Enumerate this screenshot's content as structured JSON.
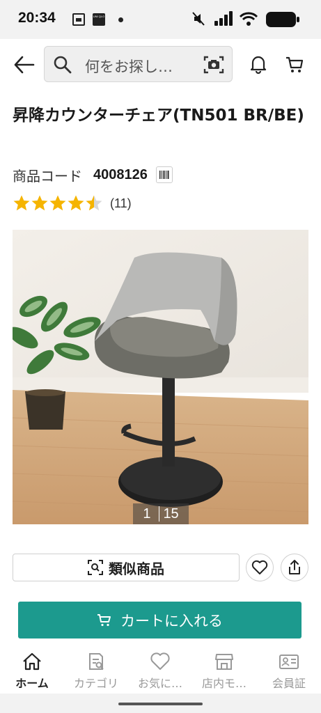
{
  "status_bar": {
    "time": "20:34",
    "app_icon_2_text": "UNI QLO"
  },
  "header": {
    "search_placeholder": "何をお探し…"
  },
  "product": {
    "title": "昇降カウンターチェア(TN501 BR/BE)",
    "code_label": "商品コード",
    "code_value": "4008126",
    "rating": 4.5,
    "rating_max": 5,
    "review_count": "(11)"
  },
  "gallery": {
    "current": "1",
    "total": "15"
  },
  "actions": {
    "similar_label": "類似商品",
    "add_to_cart_label": "カートに入れる"
  },
  "tabbar": {
    "items": [
      {
        "label": "ホーム",
        "icon": "home-icon",
        "active": true
      },
      {
        "label": "カテゴリ",
        "icon": "category-icon",
        "active": false
      },
      {
        "label": "お気に…",
        "icon": "heart-icon",
        "active": false
      },
      {
        "label": "店内モ…",
        "icon": "store-icon",
        "active": false
      },
      {
        "label": "会員証",
        "icon": "member-card-icon",
        "active": false
      }
    ]
  },
  "colors": {
    "accent": "#1c9a8e",
    "star": "#f5b400"
  }
}
